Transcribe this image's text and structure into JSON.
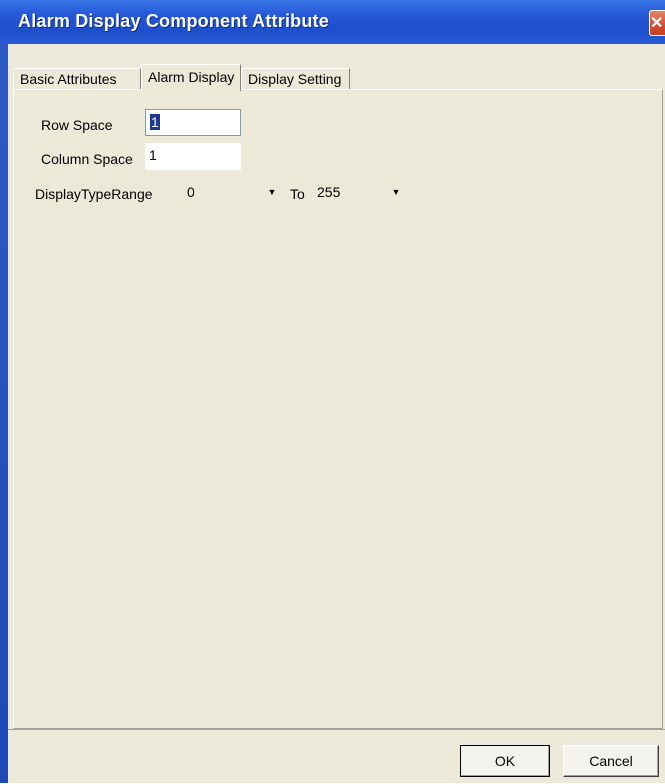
{
  "window": {
    "title": "Alarm Display Component Attribute",
    "close_glyph": "✕"
  },
  "tabs": [
    {
      "label": "Basic Attributes",
      "active": false
    },
    {
      "label": "Alarm Display",
      "active": true
    },
    {
      "label": "Display Setting",
      "active": false
    }
  ],
  "form": {
    "row_space_label": "Row Space",
    "row_space_value": "1",
    "column_space_label": "Column Space",
    "column_space_value": "1",
    "display_type_range_label": "DisplayTypeRange",
    "range_from_value": "0",
    "to_label": "To",
    "range_to_value": "255"
  },
  "buttons": {
    "ok": "OK",
    "cancel": "Cancel"
  },
  "icons": {
    "close": "close-icon",
    "dropdown": "chevron-down-icon"
  },
  "colors": {
    "titlebar": "#2456d6",
    "client_bg": "#ece9d8",
    "close_button": "#d44d2e"
  }
}
